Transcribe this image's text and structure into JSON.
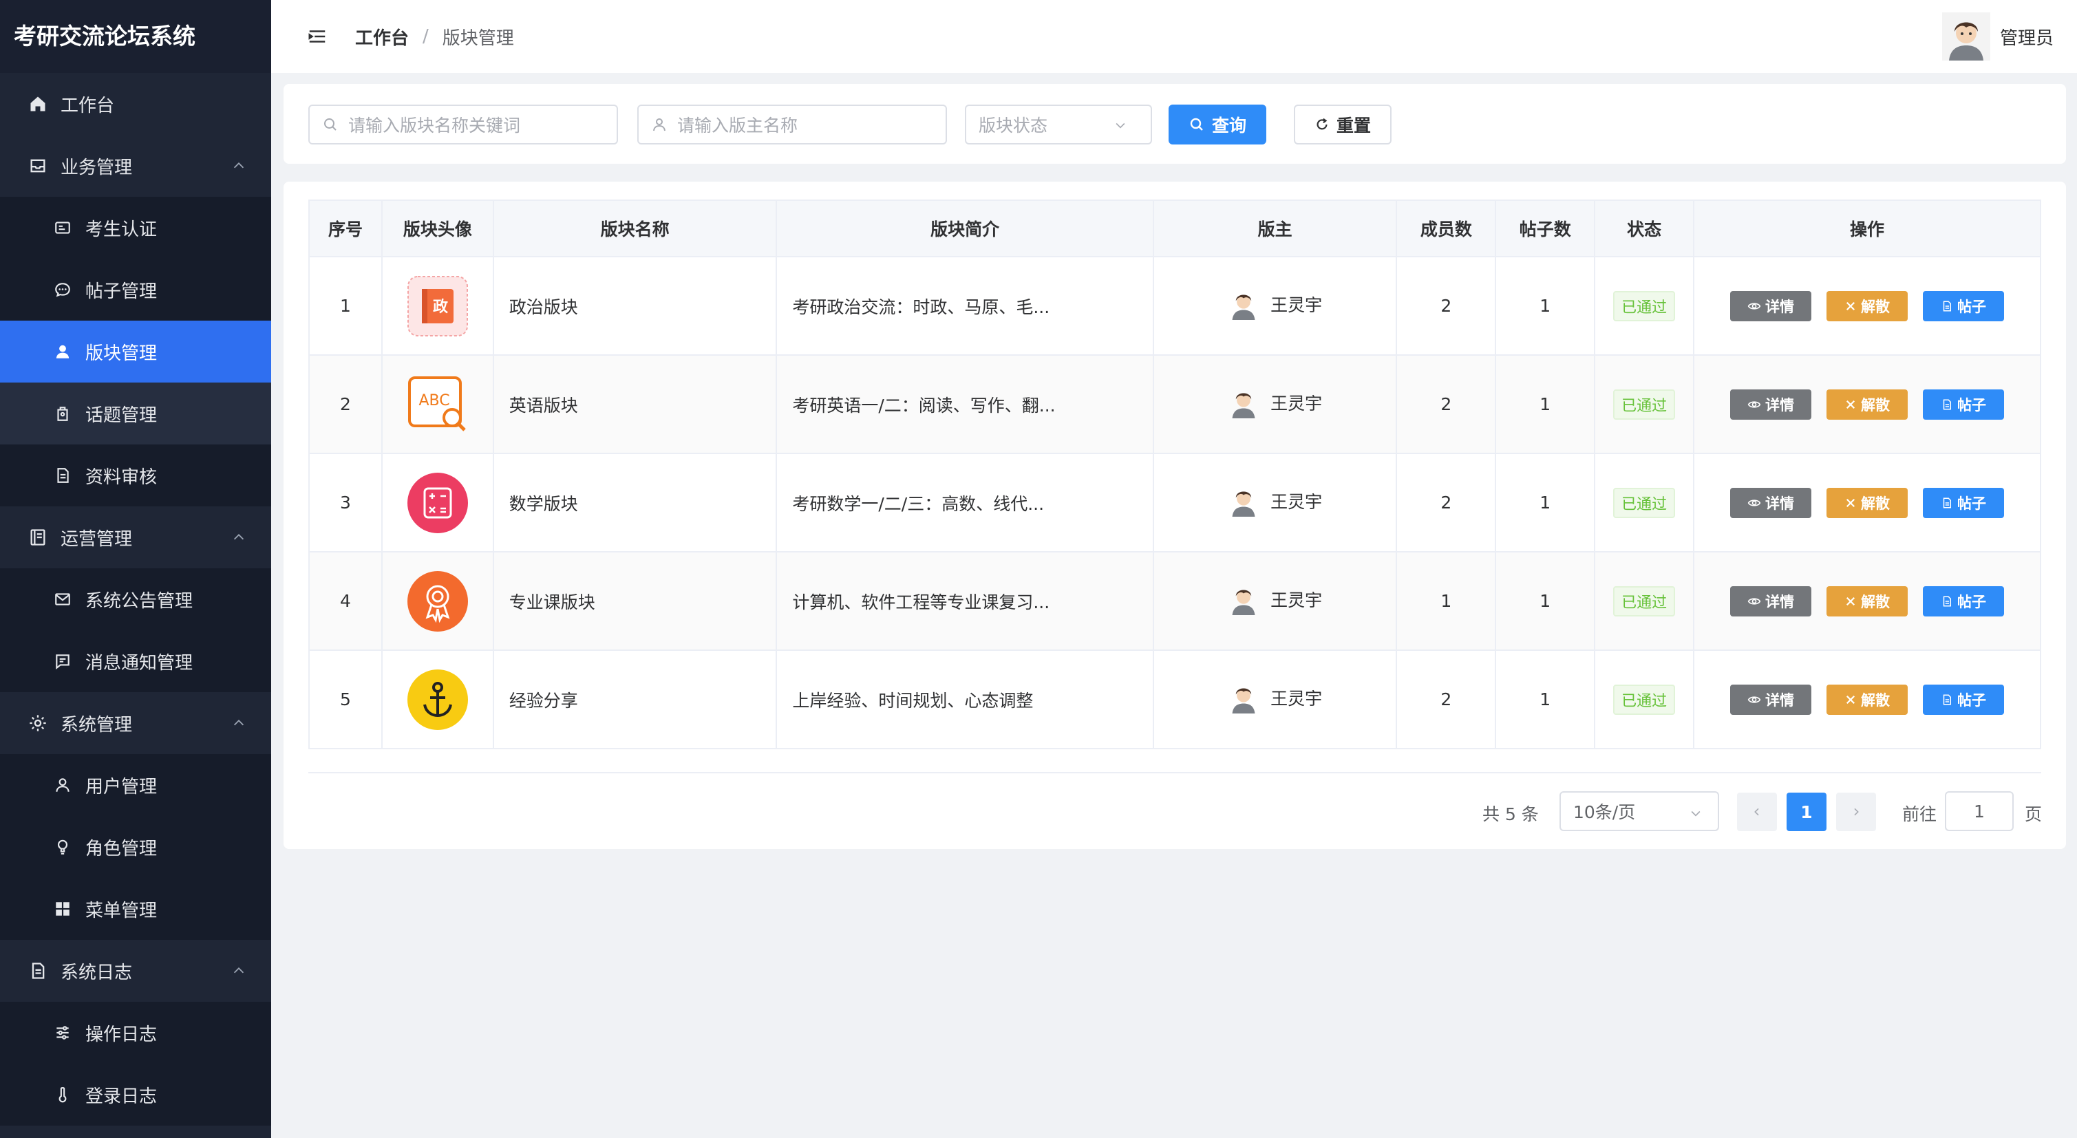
{
  "sidebar": {
    "brand": "考研交流论坛系统",
    "items": [
      {
        "label": "工作台"
      },
      {
        "label": "业务管理"
      },
      {
        "label": "考生认证"
      },
      {
        "label": "帖子管理"
      },
      {
        "label": "版块管理"
      },
      {
        "label": "话题管理"
      },
      {
        "label": "资料审核"
      },
      {
        "label": "运营管理"
      },
      {
        "label": "系统公告管理"
      },
      {
        "label": "消息通知管理"
      },
      {
        "label": "系统管理"
      },
      {
        "label": "用户管理"
      },
      {
        "label": "角色管理"
      },
      {
        "label": "菜单管理"
      },
      {
        "label": "系统日志"
      },
      {
        "label": "操作日志"
      },
      {
        "label": "登录日志"
      }
    ]
  },
  "header": {
    "breadcrumb_home": "工作台",
    "breadcrumb_sep": "/",
    "breadcrumb_current": "版块管理",
    "user_name": "管理员"
  },
  "search": {
    "name_placeholder": "请输入版块名称关键词",
    "owner_placeholder": "请输入版主名称",
    "status_placeholder": "版块状态",
    "query_label": "查询",
    "reset_label": "重置"
  },
  "table": {
    "columns": [
      "序号",
      "版块头像",
      "版块名称",
      "版块简介",
      "版主",
      "成员数",
      "帖子数",
      "状态",
      "操作"
    ],
    "rows": [
      {
        "index": "1",
        "name": "政治版块",
        "intro": "考研政治交流：时政、马原、毛...",
        "owner": "王灵宇",
        "members": "2",
        "posts": "1",
        "status": "已通过",
        "icon_label": "政"
      },
      {
        "index": "2",
        "name": "英语版块",
        "intro": "考研英语一/二：阅读、写作、翻...",
        "owner": "王灵宇",
        "members": "2",
        "posts": "1",
        "status": "已通过",
        "icon_label": "ABC"
      },
      {
        "index": "3",
        "name": "数学版块",
        "intro": "考研数学一/二/三：高数、线代...",
        "owner": "王灵宇",
        "members": "2",
        "posts": "1",
        "status": "已通过"
      },
      {
        "index": "4",
        "name": "专业课版块",
        "intro": "计算机、软件工程等专业课复习...",
        "owner": "王灵宇",
        "members": "1",
        "posts": "1",
        "status": "已通过"
      },
      {
        "index": "5",
        "name": "经验分享",
        "intro": "上岸经验、时间规划、心态调整",
        "owner": "王灵宇",
        "members": "2",
        "posts": "1",
        "status": "已通过"
      }
    ],
    "ops": {
      "detail": "详情",
      "dissolve": "解散",
      "posts": "帖子"
    }
  },
  "pagination": {
    "total": "共 5 条",
    "page_size": "10条/页",
    "current_page": "1",
    "goto_label": "前往",
    "goto_value": "1",
    "page_suffix": "页"
  },
  "colors": {
    "sidebar_bg": "#1f2636",
    "active": "#2f6ff0",
    "primary": "#2f8cf8",
    "warning": "#e6a23c",
    "info": "#73767a",
    "success": "#67c23a"
  }
}
